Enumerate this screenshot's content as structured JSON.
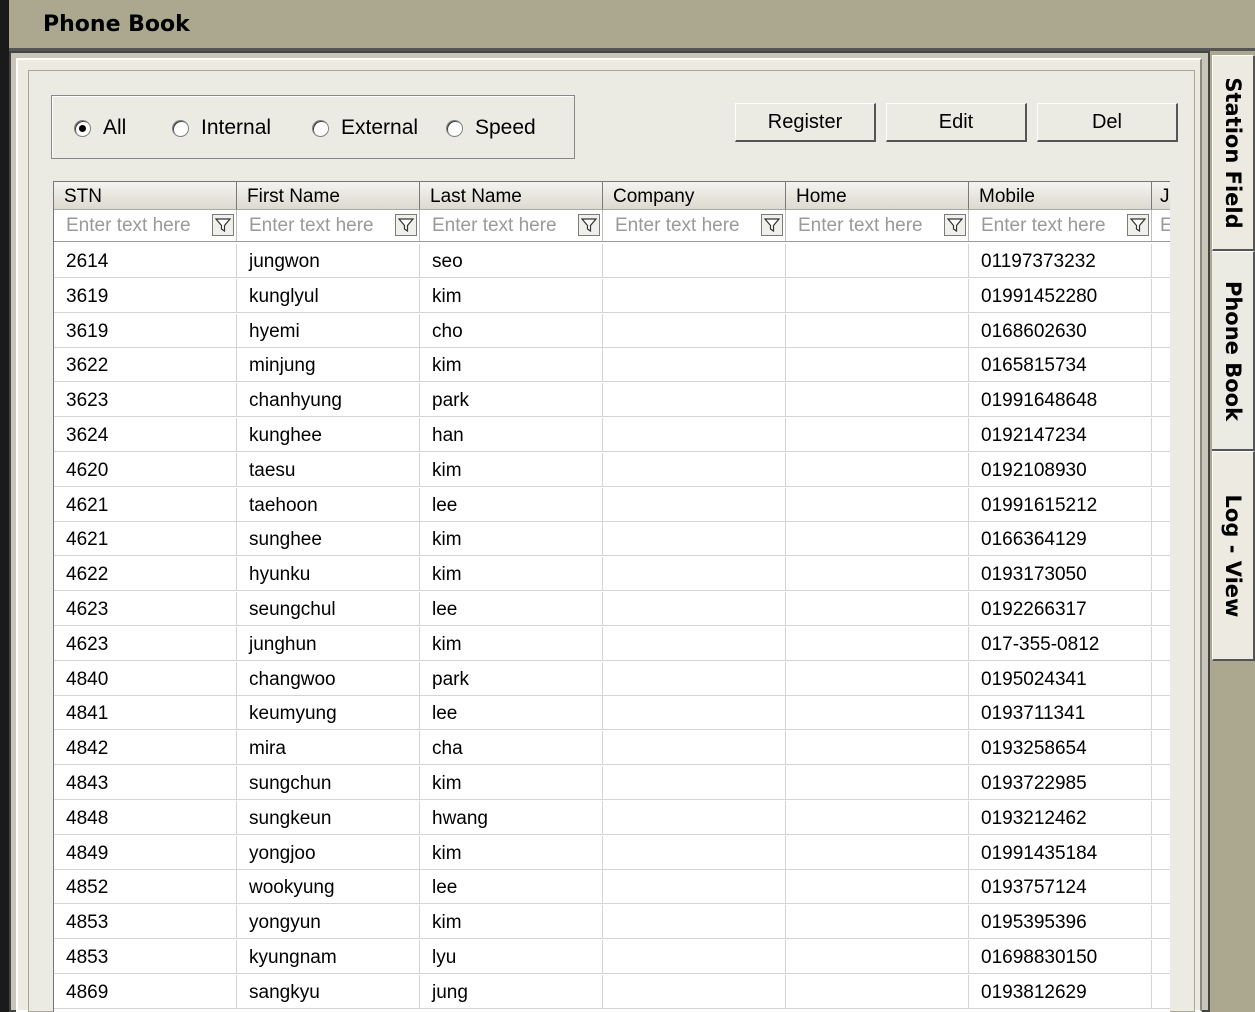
{
  "window": {
    "title": "Phone Book"
  },
  "filter": {
    "options": [
      "All",
      "Internal",
      "External",
      "Speed"
    ],
    "selected": "All"
  },
  "toolbar": {
    "register_label": "Register",
    "edit_label": "Edit",
    "del_label": "Del"
  },
  "grid": {
    "columns": [
      "STN",
      "First Name",
      "Last Name",
      "Company",
      "Home",
      "Mobile",
      "Jo"
    ],
    "filter_placeholder": "Enter text here",
    "last_filter_placeholder": "En",
    "rows": [
      [
        "2614",
        "jungwon",
        "seo",
        "",
        "",
        "01197373232"
      ],
      [
        "3619",
        "kunglyul",
        "kim",
        "",
        "",
        "01991452280"
      ],
      [
        "3619",
        "hyemi",
        "cho",
        "",
        "",
        "0168602630"
      ],
      [
        "3622",
        "minjung",
        "kim",
        "",
        "",
        "0165815734"
      ],
      [
        "3623",
        "chanhyung",
        "park",
        "",
        "",
        "01991648648"
      ],
      [
        "3624",
        "kunghee",
        "han",
        "",
        "",
        "0192147234"
      ],
      [
        "4620",
        "taesu",
        "kim",
        "",
        "",
        "0192108930"
      ],
      [
        "4621",
        "taehoon",
        "lee",
        "",
        "",
        "01991615212"
      ],
      [
        "4621",
        "sunghee",
        "kim",
        "",
        "",
        "0166364129"
      ],
      [
        "4622",
        "hyunku",
        "kim",
        "",
        "",
        "0193173050"
      ],
      [
        "4623",
        "seungchul",
        "lee",
        "",
        "",
        "0192266317"
      ],
      [
        "4623",
        "junghun",
        "kim",
        "",
        "",
        "017-355-0812"
      ],
      [
        "4840",
        "changwoo",
        "park",
        "",
        "",
        "0195024341"
      ],
      [
        "4841",
        "keumyung",
        "lee",
        "",
        "",
        "0193711341"
      ],
      [
        "4842",
        "mira",
        "cha",
        "",
        "",
        "0193258654"
      ],
      [
        "4843",
        "sungchun",
        "kim",
        "",
        "",
        "0193722985"
      ],
      [
        "4848",
        "sungkeun",
        "hwang",
        "",
        "",
        "0193212462"
      ],
      [
        "4849",
        "yongjoo",
        "kim",
        "",
        "",
        "01991435184"
      ],
      [
        "4852",
        "wookyung",
        "lee",
        "",
        "",
        "0193757124"
      ],
      [
        "4853",
        "yongyun",
        "kim",
        "",
        "",
        "0195395396"
      ],
      [
        "4853",
        "kyungnam",
        "lyu",
        "",
        "",
        "01698830150"
      ],
      [
        "4869",
        "sangkyu",
        "jung",
        "",
        "",
        "0193812629"
      ]
    ]
  },
  "side_tabs": [
    {
      "label": "Station Field",
      "active": false
    },
    {
      "label": "Phone Book",
      "active": true
    },
    {
      "label": "Log - View",
      "active": false
    }
  ],
  "icons": {
    "filter": "funnel-icon",
    "radio": "radio-button-icon"
  }
}
